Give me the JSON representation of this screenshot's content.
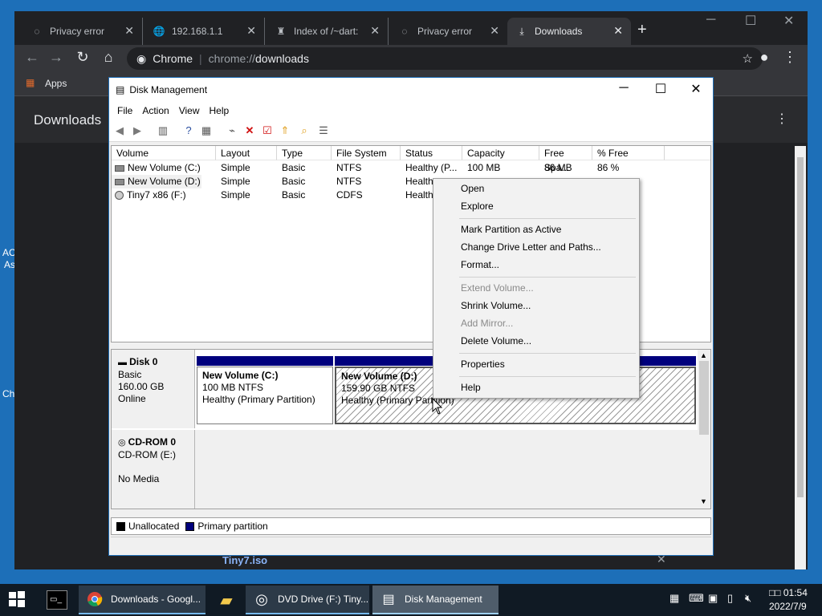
{
  "desktop": {
    "left_labels": [
      "AC",
      "As",
      "Ch"
    ]
  },
  "chrome": {
    "tabs": [
      {
        "title": "Privacy error",
        "icon": "globe-icon"
      },
      {
        "title": "192.168.1.1",
        "icon": "globe-icon"
      },
      {
        "title": "Index of /~dart:",
        "icon": "folder-icon"
      },
      {
        "title": "Privacy error",
        "icon": "globe-icon"
      },
      {
        "title": "Downloads",
        "icon": "download-icon"
      }
    ],
    "address_prefix": "Chrome",
    "address_scheme": "chrome://",
    "address_path": "downloads",
    "bookmarks_apps": "Apps",
    "page_title": "Downloads",
    "download_file": "Tiny7.iso"
  },
  "disk_management": {
    "title": "Disk Management",
    "menu": [
      "File",
      "Action",
      "View",
      "Help"
    ],
    "columns": [
      "Volume",
      "Layout",
      "Type",
      "File System",
      "Status",
      "Capacity",
      "Free Spa...",
      "% Free"
    ],
    "rows": [
      {
        "volume": "New Volume (C:)",
        "layout": "Simple",
        "type": "Basic",
        "fs": "NTFS",
        "status": "Healthy (P...",
        "capacity": "100 MB",
        "free": "86 MB",
        "pct": "86 %"
      },
      {
        "volume": "New Volume (D:)",
        "layout": "Simple",
        "type": "Basic",
        "fs": "NTFS",
        "status": "Health",
        "capacity": "",
        "free": "",
        "pct": ""
      },
      {
        "volume": "Tiny7 x86 (F:)",
        "layout": "Simple",
        "type": "Basic",
        "fs": "CDFS",
        "status": "Health",
        "capacity": "",
        "free": "",
        "pct": ""
      }
    ],
    "disk0": {
      "name": "Disk 0",
      "kind": "Basic",
      "size": "160.00 GB",
      "state": "Online",
      "partitions": [
        {
          "name": "New Volume  (C:)",
          "size": "100 MB NTFS",
          "status": "Healthy (Primary Partition)"
        },
        {
          "name": "New Volume  (D:)",
          "size": "159.90 GB NTFS",
          "status": "Healthy (Primary Partition)"
        }
      ]
    },
    "cdrom0": {
      "name": "CD-ROM 0",
      "kind": "CD-ROM (E:)",
      "state": "No Media"
    },
    "legend": [
      {
        "label": "Unallocated",
        "color": "#000000"
      },
      {
        "label": "Primary partition",
        "color": "#00007d"
      }
    ]
  },
  "context_menu": {
    "items": [
      {
        "label": "Open",
        "enabled": true
      },
      {
        "label": "Explore",
        "enabled": true
      },
      {
        "label": "Mark Partition as Active",
        "enabled": true
      },
      {
        "label": "Change Drive Letter and Paths...",
        "enabled": true
      },
      {
        "label": "Format...",
        "enabled": true
      },
      {
        "label": "Extend Volume...",
        "enabled": false
      },
      {
        "label": "Shrink Volume...",
        "enabled": true
      },
      {
        "label": "Add Mirror...",
        "enabled": false
      },
      {
        "label": "Delete Volume...",
        "enabled": true
      },
      {
        "label": "Properties",
        "enabled": true
      },
      {
        "label": "Help",
        "enabled": true
      }
    ]
  },
  "taskbar": {
    "items": [
      {
        "label": "Downloads - Googl...",
        "icon": "chrome-icon"
      },
      {
        "label": "",
        "icon": "file-explorer-icon"
      },
      {
        "label": "DVD Drive (F:) Tiny...",
        "icon": "dvd-icon"
      },
      {
        "label": "Disk Management",
        "icon": "disk-management-icon"
      }
    ],
    "time": "01:54",
    "time_prefix": "□□",
    "date": "2022/7/9"
  },
  "colors": {
    "desktop": "#1d6fb8",
    "chrome_dark": "#202124",
    "chrome_toolbar": "#35363a",
    "partition_bar": "#00007d",
    "taskbar": "#101a24"
  }
}
